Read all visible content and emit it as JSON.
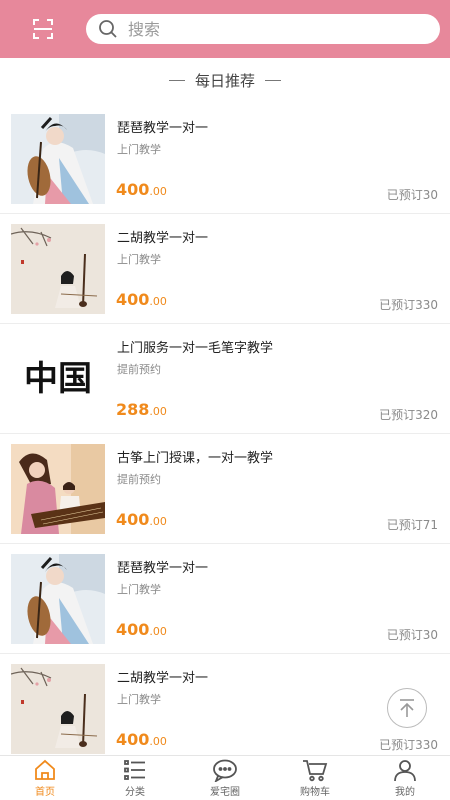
{
  "header": {
    "search_placeholder": "搜索"
  },
  "section_title": "每日推荐",
  "items": [
    {
      "title": "琵琶教学一对一",
      "subtitle": "上门教学",
      "price_int": "400",
      "price_dec": ".00",
      "booked": "已预订30",
      "thumb": "pipa-woman"
    },
    {
      "title": "二胡教学一对一",
      "subtitle": "上门教学",
      "price_int": "400",
      "price_dec": ".00",
      "booked": "已预订330",
      "thumb": "erhu-girl"
    },
    {
      "title": "上门服务一对一毛笔字教学",
      "subtitle": "提前预约",
      "price_int": "288",
      "price_dec": ".00",
      "booked": "已预订320",
      "thumb": "calligraphy"
    },
    {
      "title": "古筝上门授课，一对一教学",
      "subtitle": "提前预约",
      "price_int": "400",
      "price_dec": ".00",
      "booked": "已预订71",
      "thumb": "guzheng-lesson"
    },
    {
      "title": "琵琶教学一对一",
      "subtitle": "上门教学",
      "price_int": "400",
      "price_dec": ".00",
      "booked": "已预订30",
      "thumb": "pipa-woman"
    },
    {
      "title": "二胡教学一对一",
      "subtitle": "上门教学",
      "price_int": "400",
      "price_dec": ".00",
      "booked": "已预订330",
      "thumb": "erhu-girl"
    }
  ],
  "calligraphy_text": "中国",
  "tabbar": [
    {
      "label": "首页",
      "icon": "home-icon",
      "active": true
    },
    {
      "label": "分类",
      "icon": "category-list-icon",
      "active": false
    },
    {
      "label": "爱宅圈",
      "icon": "chat-bubble-icon",
      "active": false
    },
    {
      "label": "购物车",
      "icon": "cart-icon",
      "active": false
    },
    {
      "label": "我的",
      "icon": "user-icon",
      "active": false
    }
  ],
  "colors": {
    "header": "#e7889b",
    "accent": "#f08a1c"
  }
}
